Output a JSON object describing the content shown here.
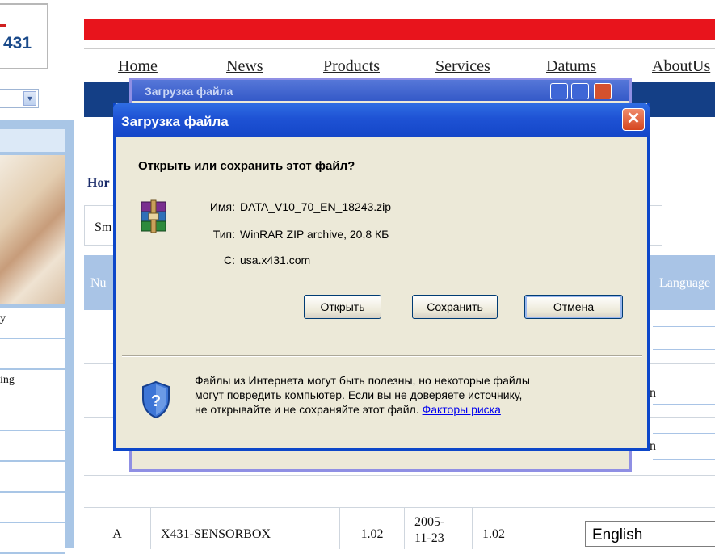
{
  "site": {
    "logo_text": "431",
    "nav": [
      "Home",
      "News",
      "Products",
      "Services",
      "Datums",
      "AboutUs"
    ],
    "home_crumb": "Hor",
    "sm_text": "Sm",
    "table_header": {
      "num": "Nu",
      "language": "Language"
    },
    "left_items": [
      "y",
      "ing"
    ],
    "right_fragments": [
      "n",
      "n"
    ],
    "data_row": {
      "col_a": "A",
      "model": "X431-SENSORBOX",
      "version": "1.02",
      "date": "2005-11-23",
      "version2": "1.02",
      "language_selected": "English"
    },
    "colors": {
      "red_bar": "#e8141c",
      "blue_bar": "#143f86",
      "table_header": "#a9c4e6"
    }
  },
  "ghost_window": {
    "title": "Загрузка файла"
  },
  "dialog": {
    "title": "Загрузка файла",
    "question": "Открыть или сохранить этот файл?",
    "name_label": "Имя:",
    "name_value": "DATA_V10_70_EN_18243.zip",
    "type_label": "Тип:",
    "type_value": "WinRAR ZIP archive, 20,8 КБ",
    "from_label": "С:",
    "from_value": "usa.x431.com",
    "open_label": "Открыть",
    "save_label": "Сохранить",
    "cancel_label": "Отмена",
    "warning_line1": "Файлы из Интернета могут быть полезны, но некоторые файлы",
    "warning_line2": "могут повредить компьютер. Если вы не доверяете источнику,",
    "warning_line3": "не открывайте и не сохраняйте этот файл.",
    "risk_link": "Факторы риска",
    "icons": {
      "file": "winrar-archive-icon",
      "shield": "security-shield-icon",
      "close": "close-icon"
    }
  }
}
